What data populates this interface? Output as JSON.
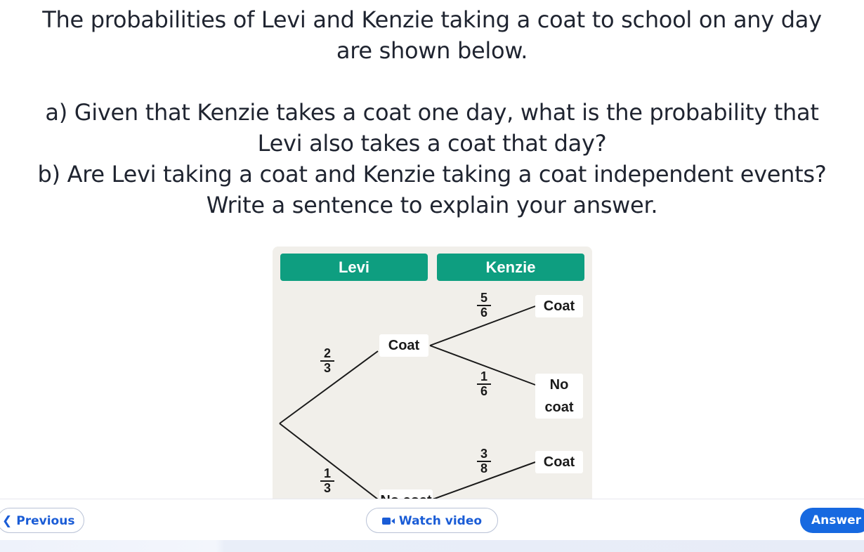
{
  "question": {
    "intro_line1": "The probabilities of Levi and Kenzie taking a coat to school on any day",
    "intro_line2": "are shown below.",
    "a_line1": "a) Given that Kenzie takes a coat one day, what is the probability that",
    "a_line2": "Levi also takes a coat that day?",
    "b_line1": "b) Are Levi taking a coat and Kenzie taking a coat independent events?",
    "b_line2": "Write a sentence to explain your answer."
  },
  "tree": {
    "header_levi": "Levi",
    "header_kenzie": "Kenzie",
    "levi_coat_label": "Coat",
    "levi_nocoat_label": "No coat",
    "k1_coat_label": "Coat",
    "k1_nocoat_label": "No coat",
    "k2_coat_label": "Coat",
    "p_levi_coat": {
      "num": "2",
      "den": "3"
    },
    "p_levi_nocoat": {
      "num": "1",
      "den": "3"
    },
    "p_k1_coat": {
      "num": "5",
      "den": "6"
    },
    "p_k1_nocoat": {
      "num": "1",
      "den": "6"
    },
    "p_k2_coat": {
      "num": "3",
      "den": "8"
    },
    "header_color": "#0e9e80",
    "background_color": "#f1efea"
  },
  "nav": {
    "previous_label": "Previous",
    "watch_video_label": "Watch video",
    "answer_label": "Answer",
    "accent_color": "#1769e0"
  }
}
